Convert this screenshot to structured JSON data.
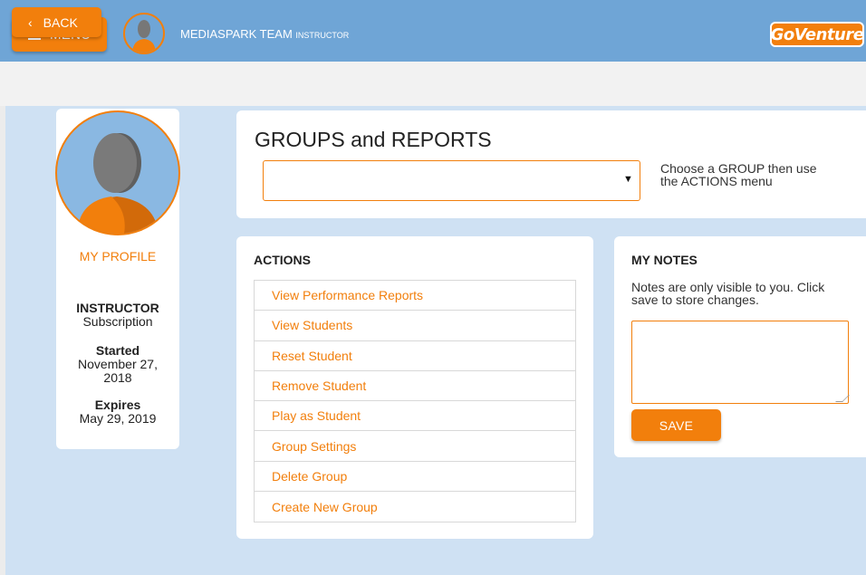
{
  "colors": {
    "accent": "#f27f0c",
    "header": "#6fa5d6",
    "background": "#cfe1f3"
  },
  "header": {
    "menu_label": "MENU",
    "menu_icon": "hamburger-icon",
    "user_name": "MEDIASPARK TEAM",
    "user_role": "INSTRUCTOR",
    "logo_text": "GoVenture"
  },
  "nav": {
    "back_label": "BACK",
    "back_icon": "chevron-left-icon"
  },
  "profile": {
    "link_label": "MY PROFILE",
    "plan_title": "INSTRUCTOR",
    "plan_type": "Subscription",
    "started_label": "Started",
    "started_value_1": "November 27,",
    "started_value_2": "2018",
    "expires_label": "Expires",
    "expires_value": "May 29, 2019"
  },
  "groups": {
    "title": "GROUPS and REPORTS",
    "selected_value": "",
    "hint_1": "Choose a GROUP then use",
    "hint_2": "the ACTIONS menu"
  },
  "actions": {
    "title": "ACTIONS",
    "items": [
      {
        "label": "View Performance Reports"
      },
      {
        "label": "View Students"
      },
      {
        "label": "Reset Student"
      },
      {
        "label": "Remove Student"
      },
      {
        "label": "Play as Student"
      },
      {
        "label": "Group Settings"
      },
      {
        "label": "Delete Group"
      },
      {
        "label": "Create New Group"
      }
    ]
  },
  "notes": {
    "title": "MY NOTES",
    "hint_1": "Notes are only visible to you. Click",
    "hint_2": "save to store changes.",
    "value": "",
    "save_label": "SAVE"
  }
}
